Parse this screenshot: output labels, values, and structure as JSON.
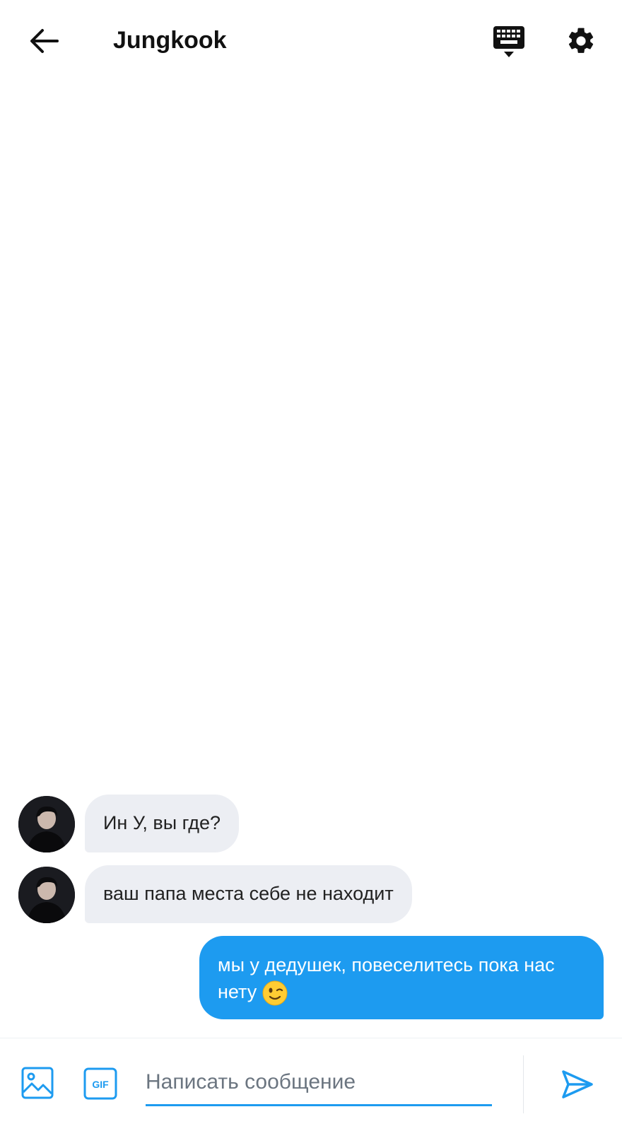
{
  "header": {
    "title": "Jungkook",
    "back_icon": "arrow-left-icon",
    "keyboard_icon": "keyboard-icon",
    "settings_icon": "gear-icon"
  },
  "messages": [
    {
      "direction": "incoming",
      "text": "Ин У, вы где?"
    },
    {
      "direction": "incoming",
      "text": "ваш папа места себе не находит"
    },
    {
      "direction": "outgoing",
      "text": "мы у дедушек, повеселитесь пока нас нету",
      "emoji": "winking-face"
    }
  ],
  "composer": {
    "placeholder": "Написать сообщение",
    "value": "",
    "media_icon": "image-icon",
    "gif_label": "GIF",
    "send_icon": "send-icon"
  },
  "colors": {
    "accent": "#1d9bf0",
    "incoming_bubble": "#eceef3",
    "text": "#111111"
  }
}
